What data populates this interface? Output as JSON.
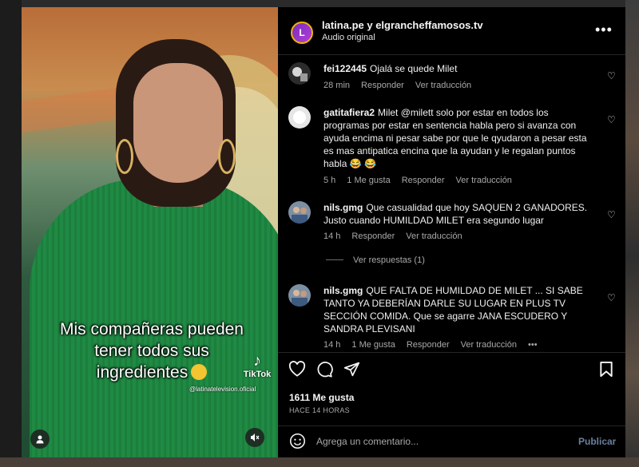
{
  "video": {
    "caption_lines": [
      "Mis compañeras pueden",
      "tener todos sus",
      "ingredientes"
    ],
    "tiktok_label": "TikTok",
    "tiktok_user": "@latinatelevision.oficial"
  },
  "post": {
    "account": "latina.pe y elgrancheffamosos.tv",
    "audio": "Audio original",
    "logo_letter": "L"
  },
  "comments": [
    {
      "user": "fei122445",
      "text": "Ojalá se quede Milet",
      "time": "28 min",
      "likes": "",
      "reply": "Responder",
      "translate": "Ver traducción"
    },
    {
      "user": "gatitafiera2",
      "text": "Milet @milett solo por estar en todos los programas por estar en sentencia habla pero si avanza con ayuda encima ni pesar sabe por que le qyudaron a pesar esta es mas antipatica encina que la ayudan y le regalan puntos habla 😂 😂",
      "time": "5 h",
      "likes": "1 Me gusta",
      "reply": "Responder",
      "translate": "Ver traducción"
    },
    {
      "user": "nils.gmg",
      "text": "Que casualidad que hoy SAQUEN 2 GANADORES. Justo cuando HUMILDAD MILET era segundo lugar",
      "time": "14 h",
      "likes": "",
      "reply": "Responder",
      "translate": "Ver traducción"
    },
    {
      "user": "nils.gmg",
      "text": "QUE FALTA DE HUMILDAD DE MILET ... SI SABE TANTO YA DEBERÍAN DARLE SU LUGAR EN PLUS TV SECCIÓN COMIDA. Que se agarre JANA ESCUDERO Y SANDRA PLEVISANI",
      "time": "14 h",
      "likes": "1 Me gusta",
      "reply": "Responder",
      "translate": "Ver traducción"
    }
  ],
  "view_replies": "Ver respuestas (1)",
  "stats": {
    "likes": "1611 Me gusta",
    "ago": "HACE 14 HORAS"
  },
  "composer": {
    "placeholder": "Agrega un comentario...",
    "publish": "Publicar"
  },
  "icons": [
    "heart-icon",
    "comment-icon",
    "share-icon",
    "bookmark-icon",
    "smile-icon",
    "more-icon",
    "mute-icon",
    "user-icon"
  ]
}
